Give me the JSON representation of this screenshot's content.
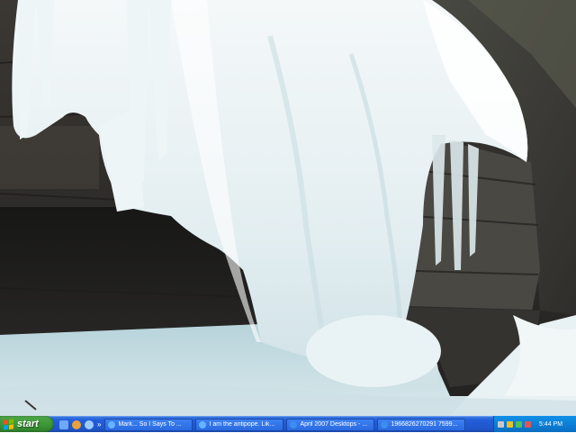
{
  "wallpaper": {
    "subject": "frozen waterfall in canyon"
  },
  "taskbar": {
    "start_label": "start",
    "start_flag_colors": [
      "#f25022",
      "#7fba00",
      "#00a4ef",
      "#ffb900"
    ],
    "quick_launch": [
      {
        "icon": "show-desktop-icon",
        "color": "#6fa8f5"
      },
      {
        "icon": "browser-icon",
        "color": "#e9a23b"
      },
      {
        "icon": "media-player-icon",
        "color": "#9ecbff"
      }
    ],
    "quick_launch_more": "»",
    "tasks": [
      {
        "label": "Mark... So I Says To ...",
        "icon": "browser-window-icon",
        "color": "#66b3ff"
      },
      {
        "label": "I am the antipope. Lik...",
        "icon": "browser-window-icon",
        "color": "#66b3ff"
      },
      {
        "label": "April 2007 Desktops - ...",
        "icon": "ie-window-icon",
        "color": "#3d8ef0"
      },
      {
        "label": "1966826270291 7599...",
        "icon": "ie-window-icon",
        "color": "#3d8ef0"
      }
    ],
    "tray_icons": [
      {
        "icon": "network-icon",
        "color": "#c8c8c8"
      },
      {
        "icon": "security-shield-icon",
        "color": "#e7c12a"
      },
      {
        "icon": "volume-icon",
        "color": "#4ec25a"
      },
      {
        "icon": "antivirus-icon",
        "color": "#e05555"
      }
    ],
    "clock": "5:44 PM"
  }
}
